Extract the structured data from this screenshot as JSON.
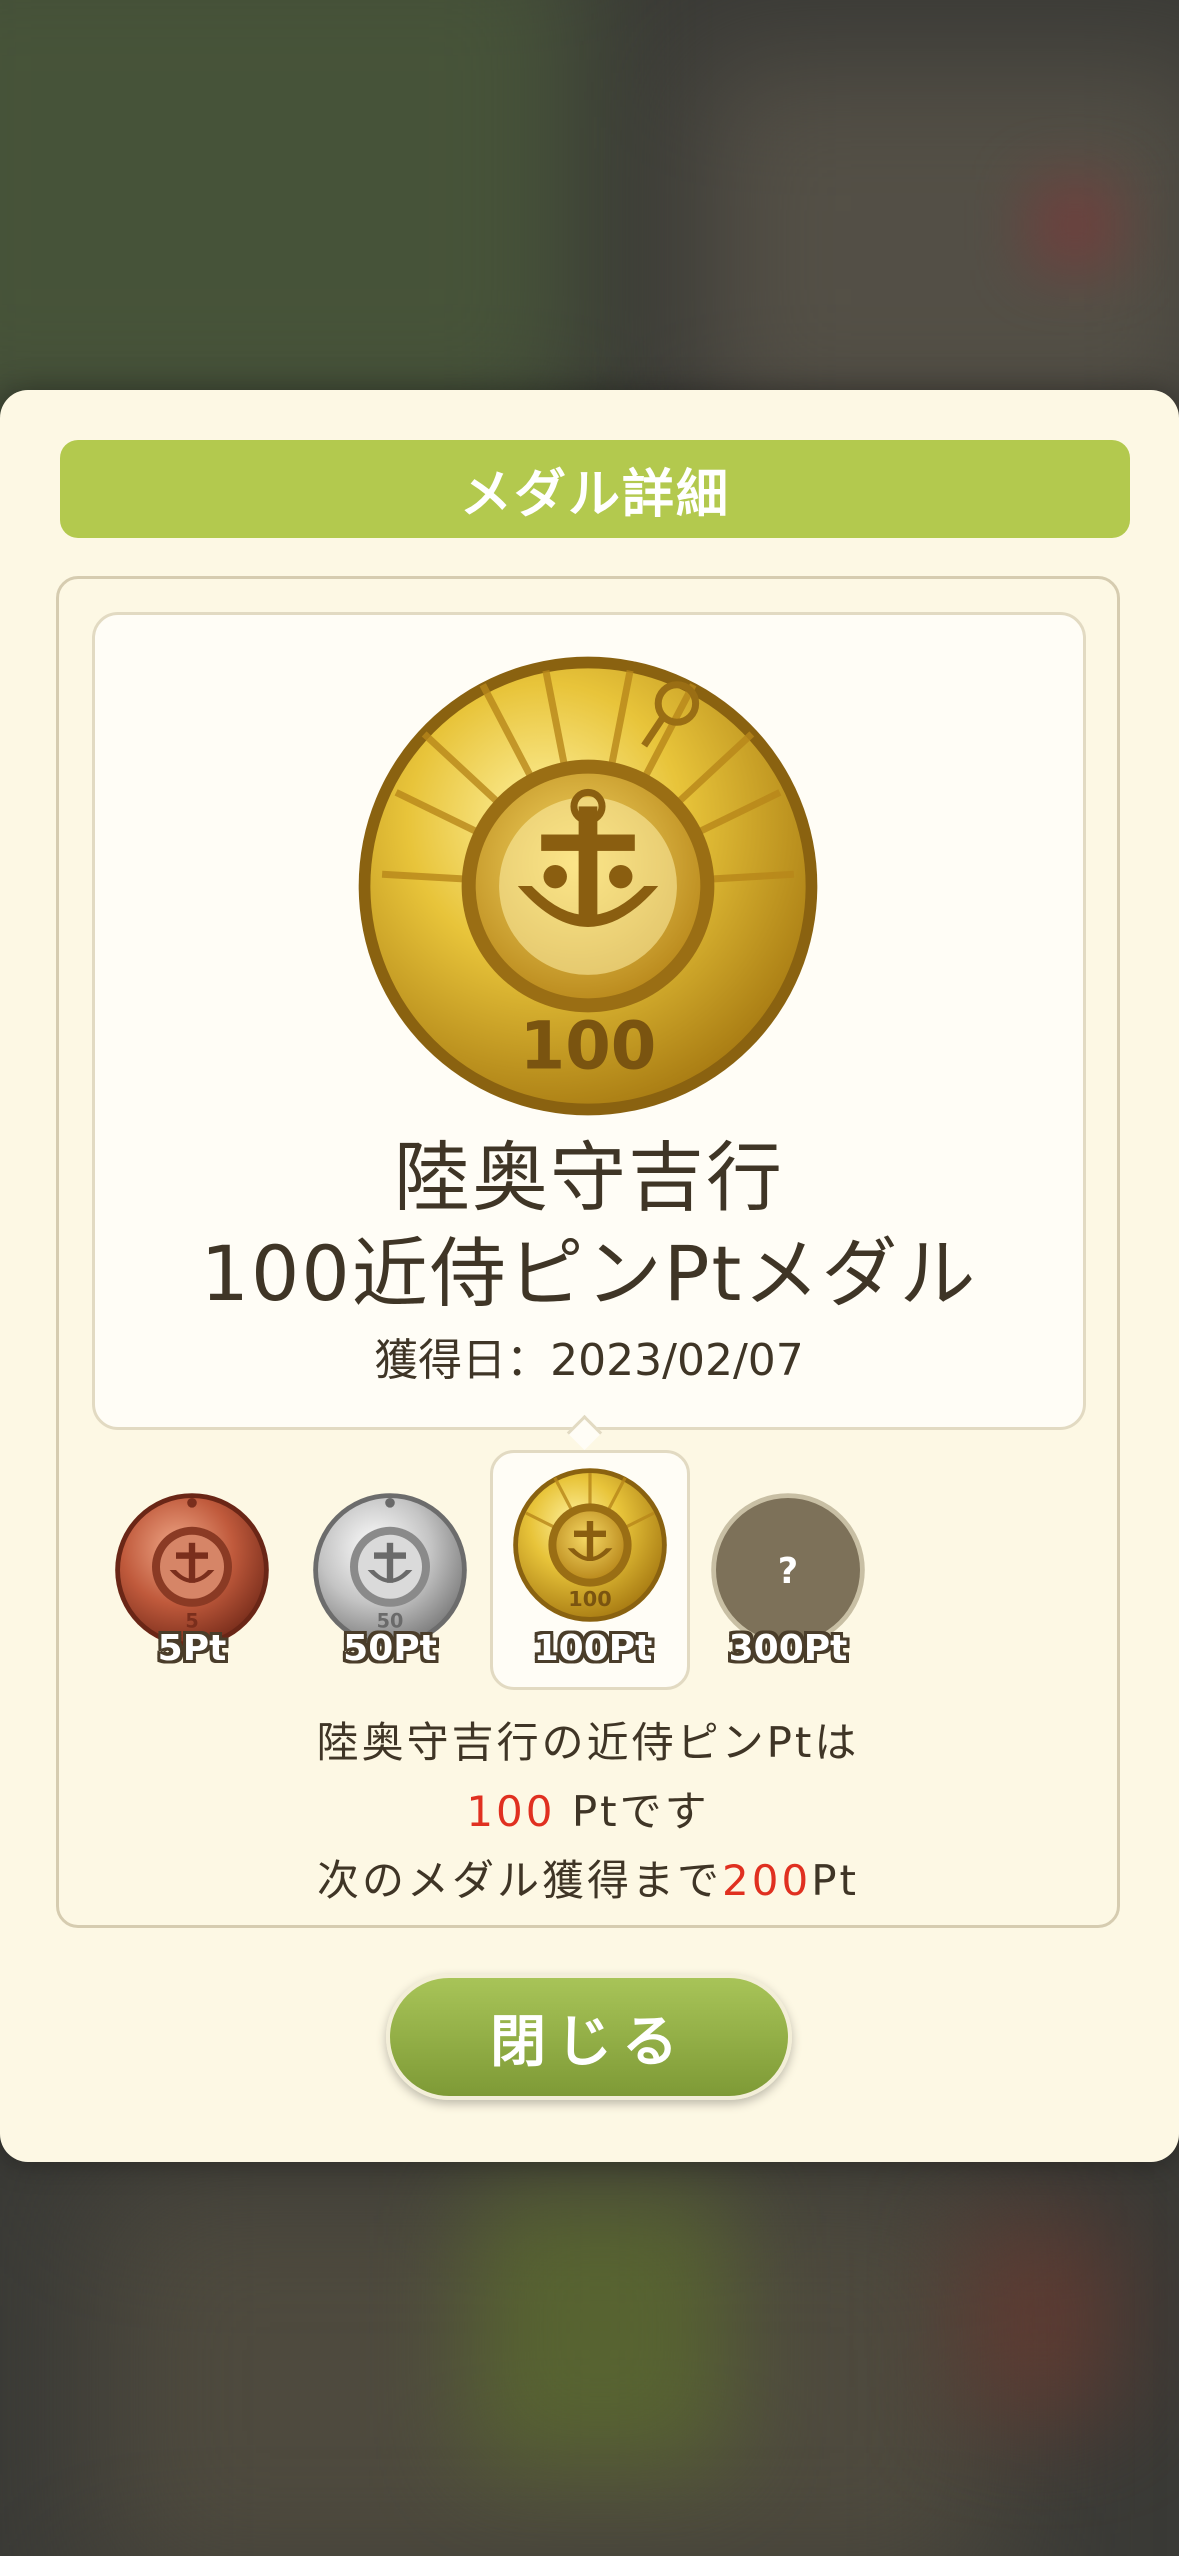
{
  "dialog": {
    "title": "メダル詳細",
    "medal_name_line1": "陸奥守吉行",
    "medal_name_line2": "100近侍ピンPtメダル",
    "acquired": "獲得日：2023/02/07",
    "big_medal_number": "100",
    "medals": [
      {
        "label": "5Pt",
        "number": "5",
        "tier": "bronze"
      },
      {
        "label": "50Pt",
        "number": "50",
        "tier": "silver"
      },
      {
        "label": "100Pt",
        "number": "100",
        "tier": "gold",
        "selected": true
      },
      {
        "label": "300Pt",
        "number": "?",
        "tier": "locked"
      }
    ],
    "info_line1": "陸奥守吉行の近侍ピンPtは",
    "info_points": "100",
    "info_line2_suffix": " Ptです",
    "info_line3_prefix": "次のメダル獲得まで",
    "info_next": "200",
    "info_line3_suffix": "Pt",
    "close_label": "閉じる"
  },
  "colors": {
    "title_bar": "#b3c94e",
    "modal_bg": "#fdf8e4",
    "highlight": "#e03020",
    "text": "#3f3526",
    "button": "#8fae42"
  }
}
